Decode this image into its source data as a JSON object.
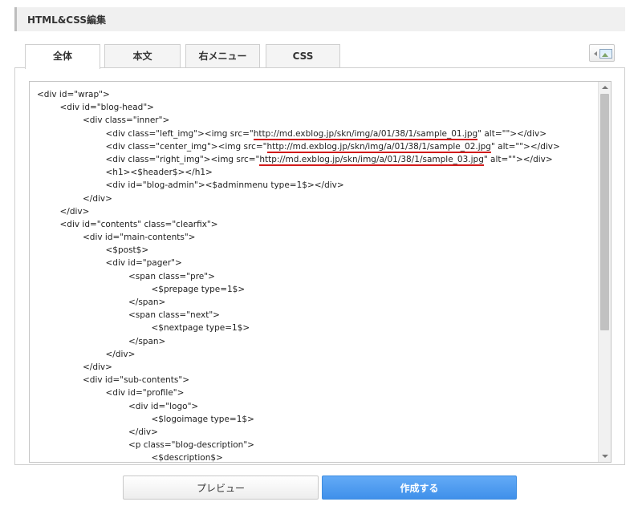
{
  "header": {
    "title": "HTML&CSS編集"
  },
  "tabs": [
    {
      "label": "全体",
      "active": true
    },
    {
      "label": "本文",
      "active": false
    },
    {
      "label": "右メニュー",
      "active": false
    },
    {
      "label": "CSS",
      "active": false
    }
  ],
  "toolbar": {
    "image_button_icon": "image-insert-icon"
  },
  "editor": {
    "lines": [
      {
        "indent": 0,
        "parts": [
          {
            "t": "<div id=\"wrap\">"
          }
        ]
      },
      {
        "indent": 1,
        "parts": [
          {
            "t": "<div id=\"blog-head\">"
          }
        ]
      },
      {
        "indent": 2,
        "parts": [
          {
            "t": "<div class=\"inner\">"
          }
        ]
      },
      {
        "indent": 3,
        "parts": [
          {
            "t": "<div class=\"left_img\"><img src=\""
          },
          {
            "t": "http://md.exblog.jp/skn/img/a/01/38/1/sample_01.jpg",
            "u": true
          },
          {
            "t": "\" alt=\"\"></div>"
          }
        ]
      },
      {
        "indent": 3,
        "parts": [
          {
            "t": "<div class=\"center_img\"><img src=\""
          },
          {
            "t": "http://md.exblog.jp/skn/img/a/01/38/1/sample_02.jpg",
            "u": true
          },
          {
            "t": "\" alt=\"\"></div>"
          }
        ]
      },
      {
        "indent": 3,
        "parts": [
          {
            "t": "<div class=\"right_img\"><img src=\""
          },
          {
            "t": "http://md.exblog.jp/skn/img/a/01/38/1/sample_03.jpg",
            "u": true
          },
          {
            "t": "\" alt=\"\"></div>"
          }
        ]
      },
      {
        "indent": 3,
        "parts": [
          {
            "t": "<h1><$header$></h1>"
          }
        ]
      },
      {
        "indent": 3,
        "parts": [
          {
            "t": "<div id=\"blog-admin\"><$adminmenu type=1$></div>"
          }
        ]
      },
      {
        "indent": 2,
        "parts": [
          {
            "t": "</div>"
          }
        ]
      },
      {
        "indent": 1,
        "parts": [
          {
            "t": "</div>"
          }
        ]
      },
      {
        "indent": 1,
        "parts": [
          {
            "t": "<div id=\"contents\" class=\"clearfix\">"
          }
        ]
      },
      {
        "indent": 2,
        "parts": [
          {
            "t": "<div id=\"main-contents\">"
          }
        ]
      },
      {
        "indent": 3,
        "parts": [
          {
            "t": "<$post$>"
          }
        ]
      },
      {
        "indent": 3,
        "parts": [
          {
            "t": "<div id=\"pager\">"
          }
        ]
      },
      {
        "indent": 4,
        "parts": [
          {
            "t": "<span class=\"pre\">"
          }
        ]
      },
      {
        "indent": 5,
        "parts": [
          {
            "t": "<$prepage type=1$>"
          }
        ]
      },
      {
        "indent": 4,
        "parts": [
          {
            "t": "</span>"
          }
        ]
      },
      {
        "indent": 4,
        "parts": [
          {
            "t": "<span class=\"next\">"
          }
        ]
      },
      {
        "indent": 5,
        "parts": [
          {
            "t": "<$nextpage type=1$>"
          }
        ]
      },
      {
        "indent": 4,
        "parts": [
          {
            "t": "</span>"
          }
        ]
      },
      {
        "indent": 3,
        "parts": [
          {
            "t": "</div>"
          }
        ]
      },
      {
        "indent": 2,
        "parts": [
          {
            "t": "</div>"
          }
        ]
      },
      {
        "indent": 2,
        "parts": [
          {
            "t": "<div id=\"sub-contents\">"
          }
        ]
      },
      {
        "indent": 3,
        "parts": [
          {
            "t": "<div id=\"profile\">"
          }
        ]
      },
      {
        "indent": 4,
        "parts": [
          {
            "t": "<div id=\"logo\">"
          }
        ]
      },
      {
        "indent": 5,
        "parts": [
          {
            "t": "<$logoimage type=1$>"
          }
        ]
      },
      {
        "indent": 4,
        "parts": [
          {
            "t": "</div>"
          }
        ]
      },
      {
        "indent": 4,
        "parts": [
          {
            "t": "<p class=\"blog-description\">"
          }
        ]
      },
      {
        "indent": 5,
        "parts": [
          {
            "t": "<$description$>"
          }
        ]
      }
    ]
  },
  "buttons": {
    "preview_label": "プレビュー",
    "create_label": "作成する"
  },
  "colors": {
    "accent": "#4a9ff5",
    "underline": "#d11a1a"
  }
}
